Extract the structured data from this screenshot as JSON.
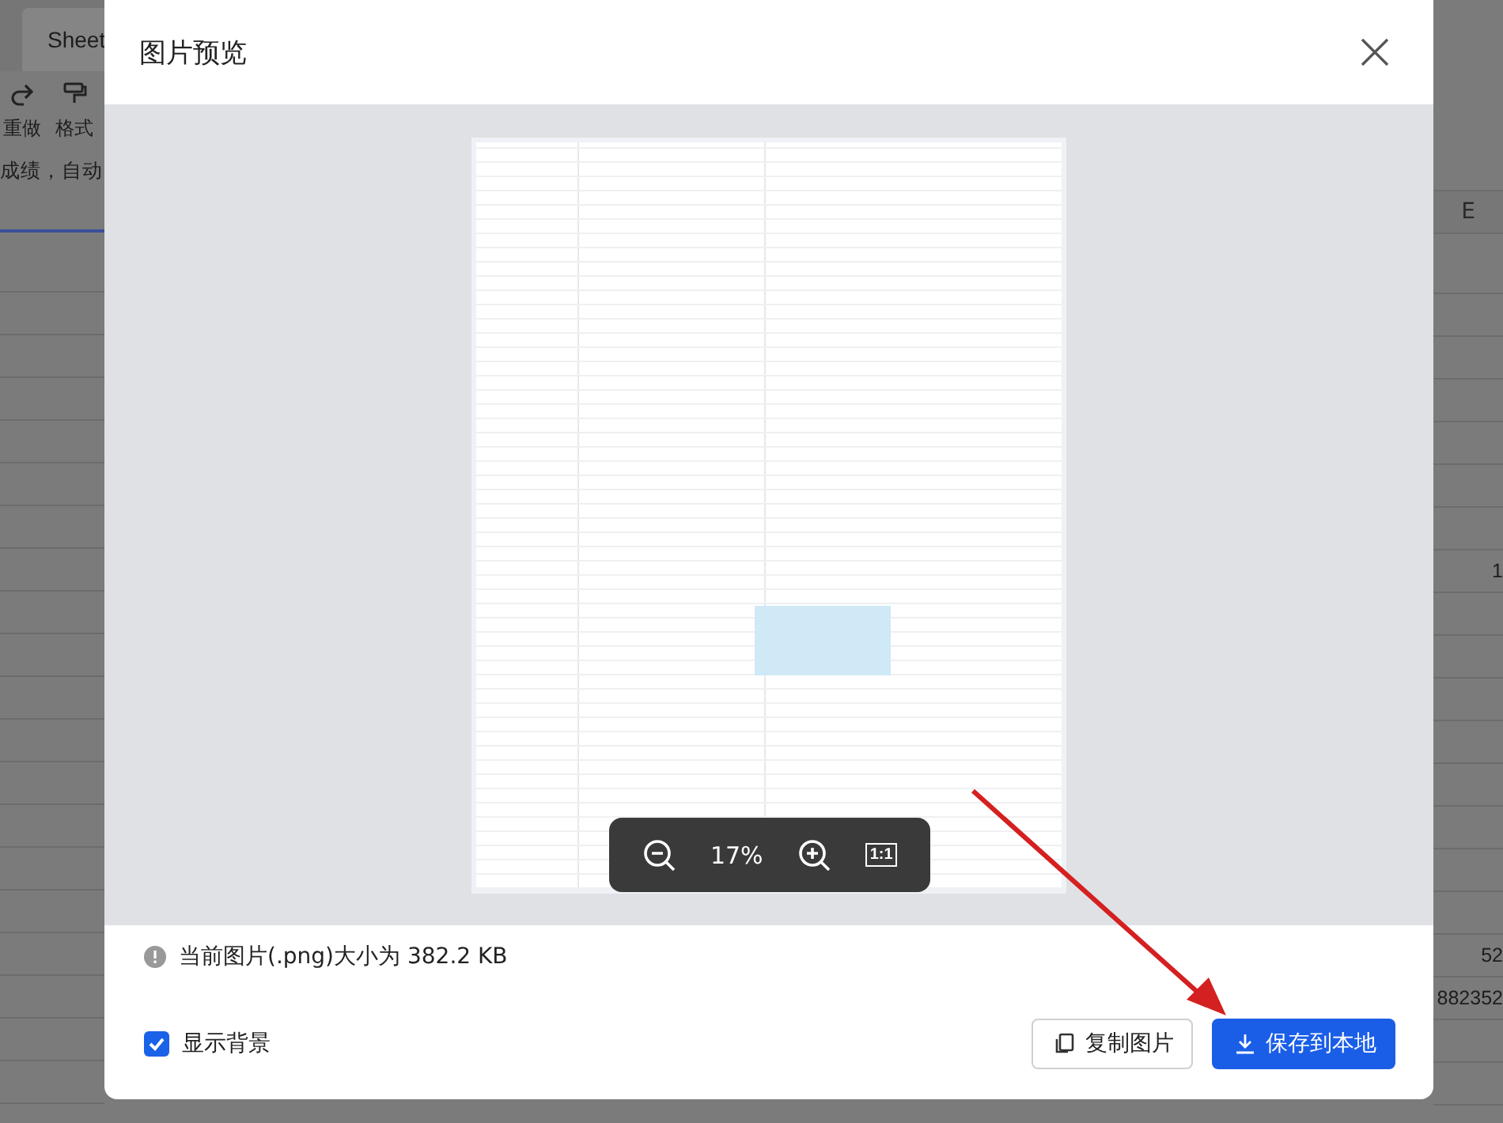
{
  "background_app": {
    "sheet_tab": "Sheet",
    "toolbar": [
      {
        "kind": "redo",
        "label": "重做"
      },
      {
        "kind": "format",
        "label": "格式"
      }
    ],
    "formula_text": "成绩，自动",
    "column_header": "E",
    "e_column_cells": [
      {},
      {},
      {},
      {},
      {},
      {},
      {},
      {
        "value": "1"
      },
      {},
      {},
      {},
      {},
      {},
      {},
      {},
      {},
      {
        "value": "52"
      },
      {
        "value": "882352"
      },
      {},
      {},
      {}
    ]
  },
  "modal": {
    "title": "图片预览",
    "zoom_bar": {
      "zoom": "17%",
      "actual_size_label": "1:1"
    },
    "file_info": "当前图片(.png)大小为 382.2 KB",
    "show_background": {
      "label": "显示背景",
      "checked": true
    },
    "buttons": [
      {
        "kind": "secondary",
        "label": "复制图片"
      },
      {
        "kind": "primary",
        "label": "保存到本地"
      }
    ]
  }
}
